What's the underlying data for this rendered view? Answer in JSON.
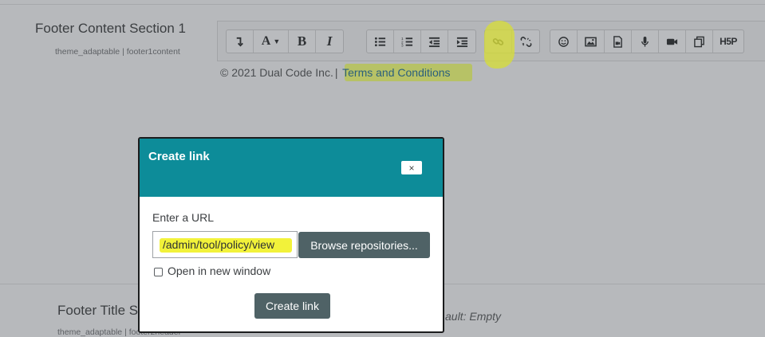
{
  "settings": {
    "footer1": {
      "title": "Footer Content Section 1",
      "subtitle": "theme_adaptable | footer1content"
    },
    "footer2": {
      "title": "Footer Title S",
      "subtitle": "theme_adaptable | footer2header",
      "default_text": "ault: Empty"
    }
  },
  "editor": {
    "content": {
      "copyright": "© 2021 Dual Code Inc.",
      "separator": "|",
      "link_text": "Terms and Conditions"
    },
    "toolbar": {
      "bold_label": "B",
      "italic_label": "I",
      "font_label": "A",
      "h5p_label": "H5P",
      "icons": [
        "collapse-icon",
        "font-color-icon",
        "bold-icon",
        "italic-icon",
        "unordered-list-icon",
        "ordered-list-icon",
        "outdent-icon",
        "indent-icon",
        "link-icon",
        "unlink-icon",
        "emoji-icon",
        "image-icon",
        "media-icon",
        "record-audio-icon",
        "record-video-icon",
        "manage-files-icon",
        "h5p-icon"
      ]
    }
  },
  "modal": {
    "title": "Create link",
    "close_label": "×",
    "url_label": "Enter a URL",
    "url_value": "/admin/tool/policy/view",
    "browse_label": "Browse repositories...",
    "new_window_label": "Open in new window",
    "new_window_checked": false,
    "submit_label": "Create link"
  },
  "colors": {
    "modal_header": "#0d8c99",
    "primary_button": "#4f6266",
    "highlight_yellow": "#f2f23a",
    "overlay_bg": "#b7b9bc"
  }
}
